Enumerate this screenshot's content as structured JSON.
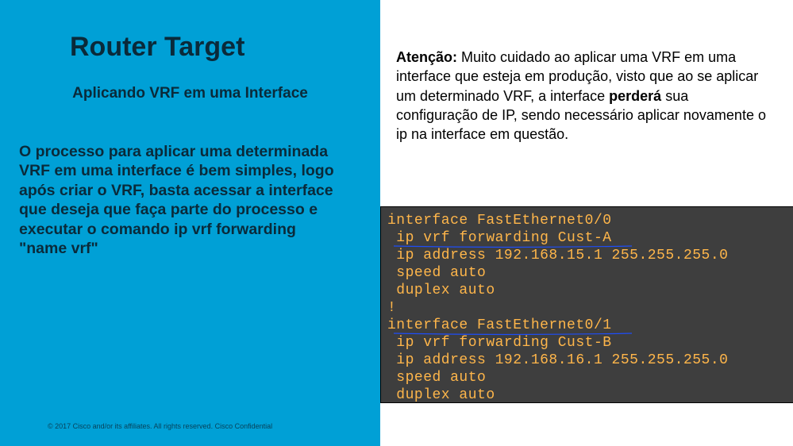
{
  "left": {
    "title": "Router Target",
    "subtitle": "Aplicando VRF em uma Interface",
    "body_prefix": "O processo para aplicar uma determinada VRF em uma interface é bem simples, logo após criar o VRF, basta acessar a interface que deseja que faça parte do processo e executar o comando ",
    "body_command": "ip vrf forwarding \"name vrf\"",
    "copyright": "© 2017  Cisco and/or its affiliates. All rights reserved.   Cisco Confidential"
  },
  "right": {
    "warning_label": "Atenção:",
    "warning_part1": " Muito cuidado ao aplicar uma VRF em uma interface que esteja em produção, visto que ao se aplicar um determinado VRF, a interface ",
    "warning_bold": "perderá",
    "warning_part2": " sua configuração de IP, sendo necessário aplicar novamente o ip na interface em questão."
  },
  "terminal": {
    "lines": [
      "interface FastEthernet0/0",
      " ip vrf forwarding Cust-A",
      " ip address 192.168.15.1 255.255.255.0",
      " speed auto",
      " duplex auto",
      "!",
      "interface FastEthernet0/1",
      " ip vrf forwarding Cust-B",
      " ip address 192.168.16.1 255.255.255.0",
      " speed auto",
      " duplex auto"
    ]
  }
}
